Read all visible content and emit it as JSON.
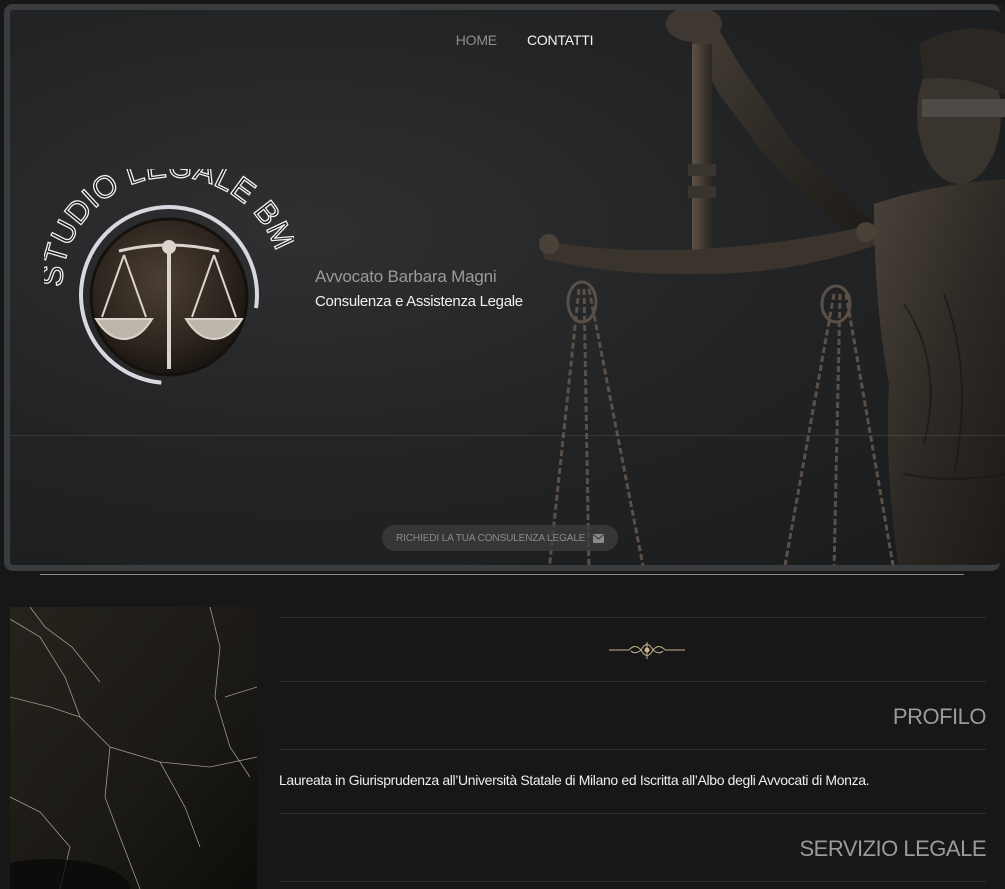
{
  "nav": {
    "home": "HOME",
    "contatti": "CONTATTI"
  },
  "logo": {
    "text": "STUDIO LEGALE BM"
  },
  "hero": {
    "name": "Avvocato Barbara Magni",
    "tagline": "Consulenza e Assistenza Legale",
    "cta_label": "RICHIEDI LA TUA CONSULENZA LEGALE"
  },
  "sections": {
    "profilo_title": "PROFILO",
    "profilo_text": "Laureata in Giurisprudenza all’Università Statale di Milano ed Iscritta all’Albo degli Avvocati di Monza.",
    "servizio_title": "SERVIZIO LEGALE"
  },
  "icons": {
    "cta_icon": "envelope-icon",
    "ornament": "flourish-ornament-icon",
    "logo_scales": "scales-of-justice-icon"
  },
  "colors": {
    "background": "#171717",
    "hero": "#232425",
    "accent_bronze": "#6b5a44",
    "muted_text": "#9a9a9a"
  }
}
